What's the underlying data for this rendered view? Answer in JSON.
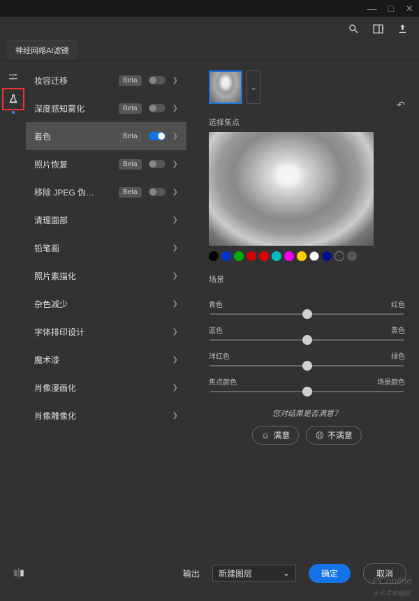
{
  "tab_title": "神经网络AI滤镜",
  "filters": [
    {
      "label": "妆容迁移",
      "beta": true,
      "on": false
    },
    {
      "label": "深度感知雾化",
      "beta": true,
      "on": false
    },
    {
      "label": "着色",
      "beta": true,
      "on": true,
      "selected": true
    },
    {
      "label": "照片恢复",
      "beta": true,
      "on": false
    },
    {
      "label": "移除 JPEG 伪…",
      "beta": true,
      "on": false
    },
    {
      "label": "清理面部",
      "beta": false,
      "on": false
    },
    {
      "label": "铅笔画",
      "beta": false,
      "on": false
    },
    {
      "label": "照片素描化",
      "beta": false,
      "on": false
    },
    {
      "label": "杂色减少",
      "beta": false,
      "on": false
    },
    {
      "label": "字体排印设计",
      "beta": false,
      "on": false
    },
    {
      "label": "魔术漆",
      "beta": false,
      "on": false
    },
    {
      "label": "肖像漫画化",
      "beta": false,
      "on": false
    },
    {
      "label": "肖像雕像化",
      "beta": false,
      "on": false
    }
  ],
  "panel": {
    "focus_label": "选择焦点",
    "scene_label": "场景",
    "sliders": [
      {
        "left": "青色",
        "right": "红色"
      },
      {
        "left": "蓝色",
        "right": "黄色"
      },
      {
        "left": "洋红色",
        "right": "绿色"
      },
      {
        "left": "焦点颜色",
        "right": "场景颜色"
      }
    ],
    "swatches": [
      "#000000",
      "#0033cc",
      "#00aa00",
      "#cc0000",
      "#dd0000",
      "#00bbbb",
      "#ee00ee",
      "#ffcc00",
      "#ffffff",
      "#001188"
    ],
    "feedback_q": "您对结果是否满意？",
    "fb_yes": "满意",
    "fb_no": "不满意"
  },
  "footer": {
    "output_label": "输出",
    "output_value": "新建图层",
    "ok": "确定",
    "cancel": "取消"
  },
  "watermark": "PConline\n太平洋电脑网"
}
